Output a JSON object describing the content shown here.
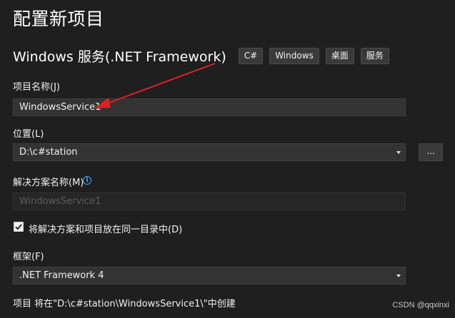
{
  "page": {
    "title": "配置新项目"
  },
  "template": {
    "name": "Windows 服务(.NET Framework)",
    "tags": [
      "C#",
      "Windows",
      "桌面",
      "服务"
    ]
  },
  "project_name": {
    "label": "项目名称(J)",
    "value": "WindowsService1"
  },
  "location": {
    "label": "位置(L)",
    "value": "D:\\c#station",
    "browse_label": "..."
  },
  "solution_name": {
    "label": "解决方案名称(M)",
    "value": "WindowsService1",
    "info_icon": "info-icon"
  },
  "same_directory": {
    "label": "将解决方案和项目放在同一目录中(D)",
    "checked": true
  },
  "framework": {
    "label": "框架(F)",
    "value": ".NET Framework 4"
  },
  "summary": {
    "text": "项目 将在\"D:\\c#station\\WindowsService1\\\"中创建"
  },
  "watermark": {
    "text": "CSDN @qqxinxi"
  },
  "annotation": {
    "color": "#e02020",
    "icon": "red-arrow"
  },
  "colors": {
    "background": "#1f1f1f",
    "input_background": "#333333",
    "info_accent": "#4aa3ff"
  }
}
